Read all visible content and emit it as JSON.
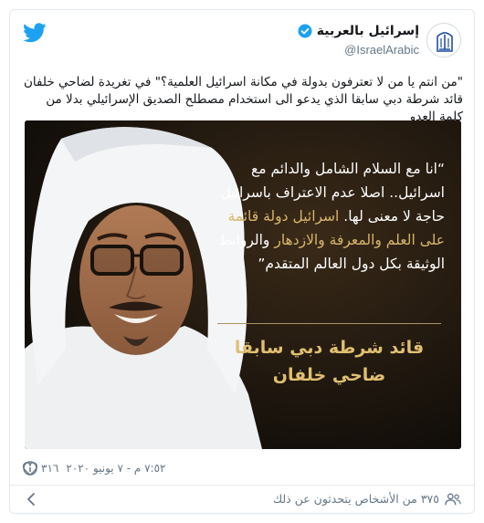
{
  "account": {
    "display_name": "إسرائيل بالعربية",
    "handle": "@IsraelArabic",
    "verified": true
  },
  "tweet": {
    "text": "\"من انتم يا من لا تعترفون بدولة في مكانة اسرائيل العلمية؟\" في تغريدة لضاحي خلفان قائد شرطة دبي سابقا الذي يدعو الى استخدام مصطلح الصديق الإسرائيلي بدلا من كلمة العدو"
  },
  "media": {
    "quote_line_1": "“انا مع السلام الشامل والدائم مع اسرائيل.. اصلا عدم الاعتراف باسرائيل حاجة لا معنى لها.",
    "quote_highlight_1": " اسرائيل دولة قائمة على العلم والمعرفة والازدهار",
    "quote_line_2": " والروابط الوثيقة بكل دول العالم المتقدم”",
    "attribution_1": "قائد شرطة دبي سابقا",
    "attribution_2": "ضاحي خلفان"
  },
  "meta": {
    "likes": "٣١٦",
    "timestamp": "٧:٥٢ م - ٧ يونيو ٢٠٢٠"
  },
  "footer": {
    "people_talking": "٣٧٥ من الأشخاص يتحدثون عن ذلك"
  },
  "colors": {
    "twitter_blue": "#1da1f2",
    "gold_text": "#d8b66a",
    "secondary_text": "#657786"
  },
  "icons": {
    "brand": "twitter-bird-icon",
    "verified": "verified-badge-icon",
    "like": "heart-icon",
    "info": "info-icon",
    "people": "people-icon",
    "chevron": "chevron-left-icon"
  }
}
